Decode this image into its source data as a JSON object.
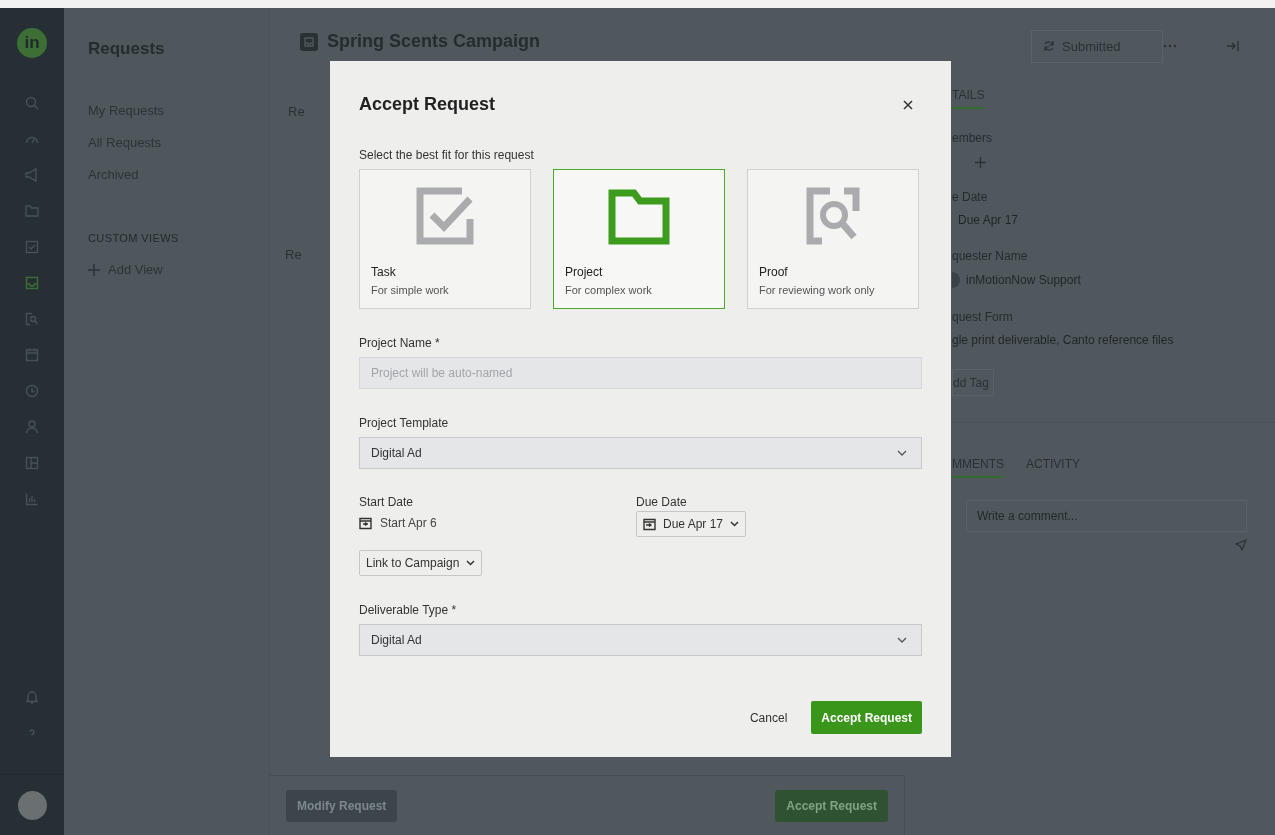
{
  "rail": {
    "logo": "in",
    "items": [
      {
        "kind": "search",
        "selected": false
      },
      {
        "kind": "gauge",
        "selected": false
      },
      {
        "kind": "megaphone",
        "selected": false
      },
      {
        "kind": "folder",
        "selected": false
      },
      {
        "kind": "task",
        "selected": false
      },
      {
        "kind": "inbox",
        "selected": true
      },
      {
        "kind": "proof",
        "selected": false
      },
      {
        "kind": "calendar",
        "selected": false
      },
      {
        "kind": "clock",
        "selected": false
      },
      {
        "kind": "person",
        "selected": false
      },
      {
        "kind": "layout",
        "selected": false
      },
      {
        "kind": "chart",
        "selected": false
      }
    ],
    "bottom": [
      {
        "kind": "bell",
        "selected": false
      },
      {
        "kind": "help",
        "selected": false
      }
    ]
  },
  "sidebar": {
    "title": "Requests",
    "items": [
      {
        "label": "My Requests"
      },
      {
        "label": "All Requests"
      },
      {
        "label": "Archived"
      }
    ],
    "section_heading": "CUSTOM VIEWS",
    "add_view": "Add View"
  },
  "main": {
    "title": "Spring Scents Campaign",
    "fragments": [
      "Re",
      "Re"
    ],
    "status": "Submitted",
    "footer_buttons": [
      {
        "label": "Modify Request",
        "kind": "secondary"
      },
      {
        "label": "Accept Request",
        "kind": "primary"
      }
    ]
  },
  "details": {
    "tabs": [
      {
        "label": "TAILS",
        "selected": true
      }
    ],
    "members_label": "embers",
    "fields": [
      {
        "label": "e Date",
        "value": "Due Apr 17",
        "kind": "date"
      },
      {
        "label": "quester Name",
        "value": "inMotionNow Support",
        "kind": "person"
      },
      {
        "label": "quest Form",
        "value": "gle print deliverable, Canto reference files",
        "kind": "text"
      }
    ],
    "add_tag": "dd Tag",
    "activity_tabs": [
      {
        "label": "MMENTS",
        "selected": true
      },
      {
        "label": "ACTIVITY",
        "selected": false
      }
    ],
    "comment": {
      "placeholder": "Write a comment..."
    }
  },
  "modal": {
    "title": "Accept Request",
    "prompt": "Select the best fit for this request",
    "options": [
      {
        "kind": "task",
        "label": "Task",
        "description": "For simple work",
        "selected": false
      },
      {
        "kind": "project",
        "label": "Project",
        "description": "For complex work",
        "selected": true
      },
      {
        "kind": "proof",
        "label": "Proof",
        "description": "For reviewing work only",
        "selected": false
      }
    ],
    "project_name": {
      "label": "Project Name *",
      "placeholder": "Project will be auto-named"
    },
    "project_template": {
      "label": "Project Template",
      "value": "Digital Ad"
    },
    "start_date": {
      "label": "Start Date",
      "value": "Start Apr 6"
    },
    "due_date": {
      "label": "Due Date",
      "value": "Due Apr 17"
    },
    "link_campaign": "Link to Campaign",
    "deliverable_type": {
      "label": "Deliverable Type *",
      "value": "Digital Ad"
    },
    "cancel": "Cancel",
    "accept": "Accept Request"
  }
}
